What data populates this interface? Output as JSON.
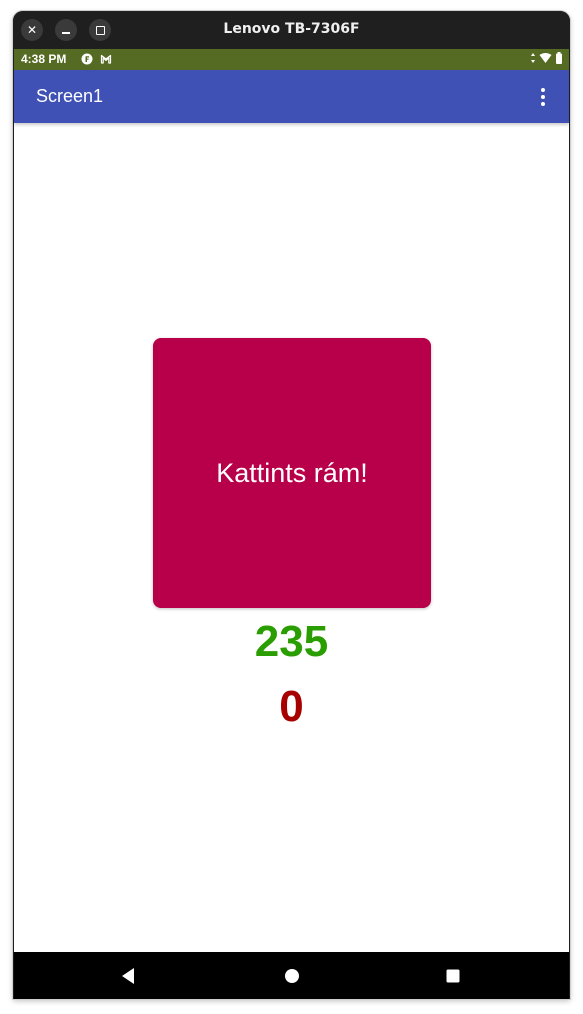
{
  "window": {
    "title": "Lenovo TB-7306F",
    "close_glyph": "✕"
  },
  "status_bar": {
    "time": "4:38 PM",
    "background": "#556b24"
  },
  "app_bar": {
    "title": "Screen1",
    "background": "#3f51b5"
  },
  "main": {
    "button_label": "Kattints rám!",
    "button_color": "#b8004a",
    "counter_green": "235",
    "counter_green_color": "#2a9d00",
    "counter_red": "0",
    "counter_red_color": "#a60000"
  },
  "icons": {
    "status_left": [
      "notification-f-icon",
      "gmail-icon"
    ],
    "status_right": [
      "data-arrows-icon",
      "wifi-icon",
      "battery-icon"
    ],
    "app_bar": "more-vert-icon",
    "nav": [
      "back-icon",
      "home-icon",
      "recents-icon"
    ]
  }
}
